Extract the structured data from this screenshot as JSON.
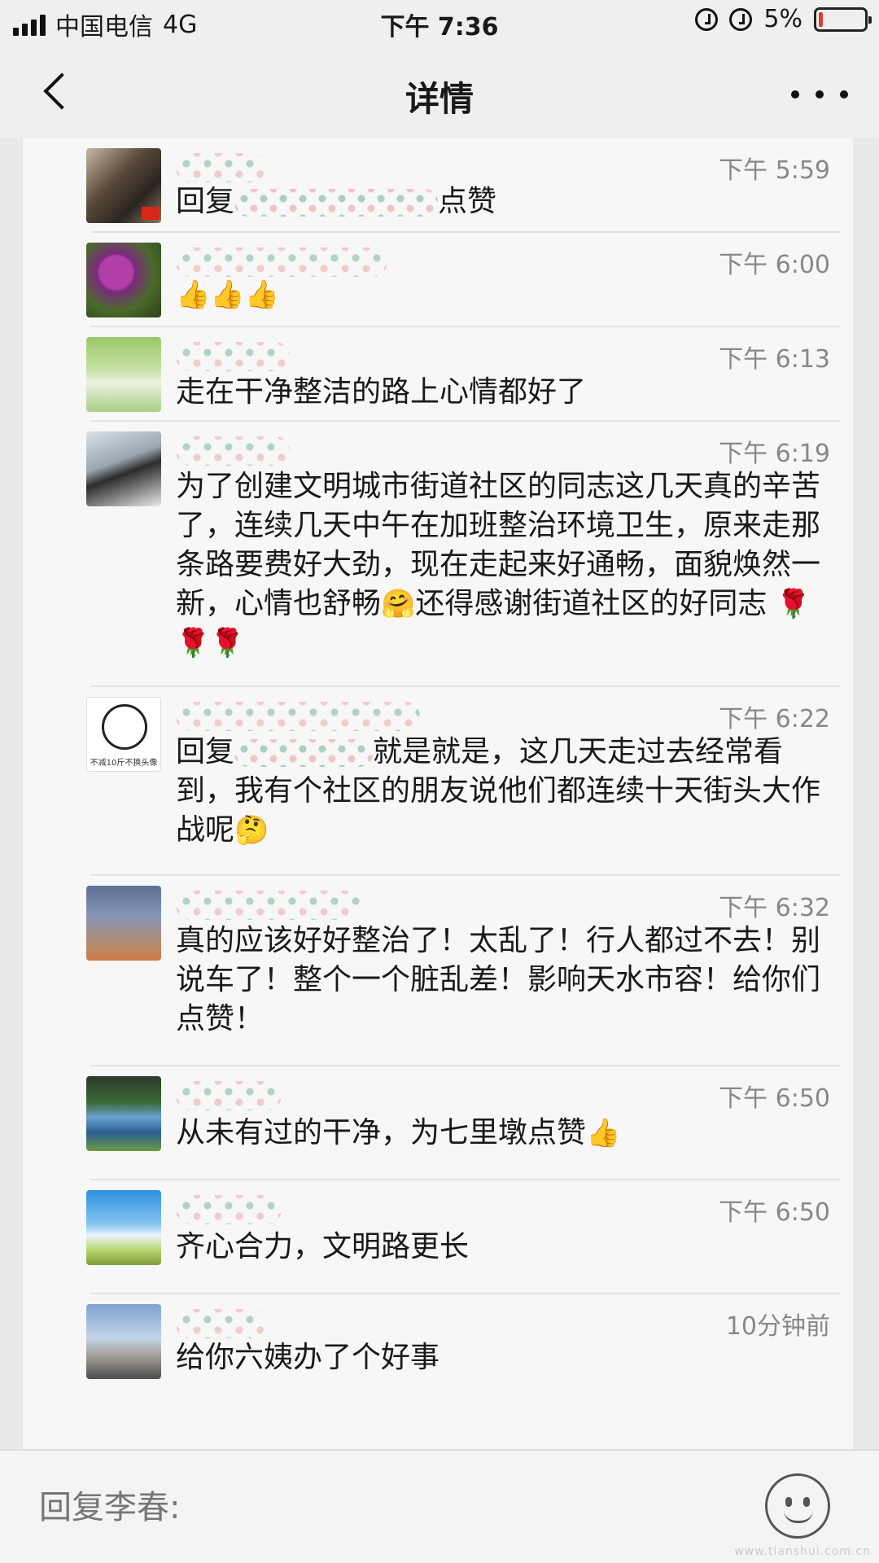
{
  "status_bar": {
    "carrier": "中国电信",
    "network": "4G",
    "time": "下午 7:36",
    "battery": "5%",
    "battery_level": 0.05
  },
  "nav": {
    "title": "详情",
    "back_icon": "chevron-left-icon",
    "more_icon": "more-dots-icon"
  },
  "comments": [
    {
      "time": "下午 5:59",
      "text_pre": "回复",
      "text_post": "点赞"
    },
    {
      "time": "下午 6:00",
      "emojis": "👍👍👍"
    },
    {
      "time": "下午 6:13",
      "text": "走在干净整洁的路上心情都好了"
    },
    {
      "time": "下午 6:19",
      "text_a": "为了创建文明城市街道社区的同志这几天真的辛苦了，连续几天中午在加班整治环境卫生，原来走那条路要费好大劲，现在走起来好通畅，面貌焕然一新，心情也舒畅",
      "emoji_mid": "🤗",
      "text_b": "还得感谢街道社区的好同志",
      "emoji_end": "🌹🌹🌹"
    },
    {
      "time": "下午 6:22",
      "avatar_caption": "不减10斤不换头像",
      "text_pre": "回复",
      "text_post": "就是就是，这几天走过去经常看到，我有个社区的朋友说他们都连续十天街头大作战呢",
      "emoji_end": "🤔"
    },
    {
      "time": "下午 6:32",
      "text": "真的应该好好整治了！太乱了！行人都过不去！别说车了！整个一个脏乱差！影响天水市容！给你们点赞！"
    },
    {
      "time": "下午 6:50",
      "text": "从未有过的干净，为七里墩点赞",
      "emoji_end": "👍"
    },
    {
      "time": "下午 6:50",
      "text": "齐心合力，文明路更长"
    },
    {
      "time": "10分钟前",
      "text": "给你六姨办了个好事"
    }
  ],
  "reply": {
    "placeholder": "回复李春:",
    "emoji_icon": "smiley-face-icon"
  },
  "watermark": "www.tianshui.com.cn"
}
